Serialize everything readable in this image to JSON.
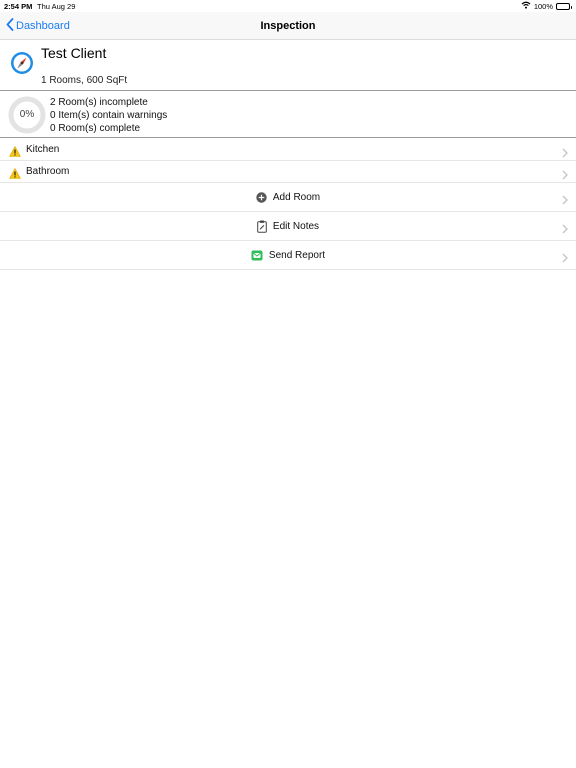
{
  "status_bar": {
    "time": "2:54 PM",
    "date": "Thu Aug 29",
    "battery": "100%",
    "icons": [
      "wifi-icon",
      "battery-icon"
    ]
  },
  "nav": {
    "back_label": "Dashboard",
    "title": "Inspection",
    "accent": "#1a7cf4"
  },
  "client": {
    "name": "Test Client",
    "details": "1 Rooms, 600 SqFt",
    "icon": "compass-icon"
  },
  "summary": {
    "progress_text": "0%",
    "progress_fraction": 0,
    "lines": [
      "2 Room(s) incomplete",
      "0 Item(s) contain warnings",
      "0 Room(s) complete"
    ]
  },
  "rooms": [
    {
      "label": "Kitchen",
      "icon": "warning-icon"
    },
    {
      "label": "Bathroom",
      "icon": "warning-icon"
    }
  ],
  "actions": [
    {
      "label": "Add Room",
      "icon": "plus-circle-icon"
    },
    {
      "label": "Edit Notes",
      "icon": "clipboard-icon"
    },
    {
      "label": "Send Report",
      "icon": "send-report-icon"
    }
  ],
  "colors": {
    "warning": "#f5c518",
    "send_green": "#2ebd59"
  }
}
